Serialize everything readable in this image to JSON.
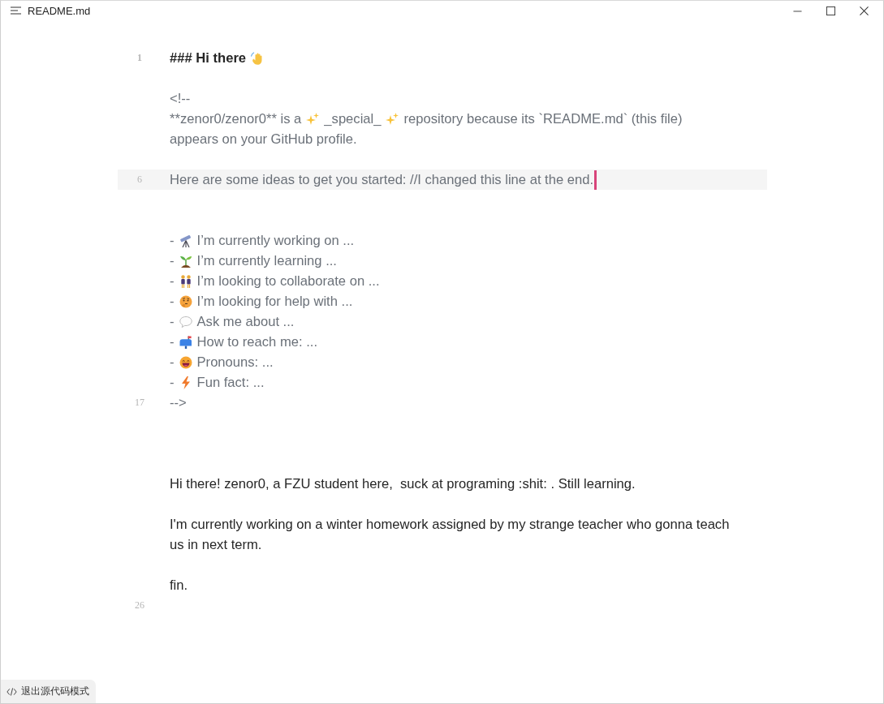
{
  "window": {
    "title": "README.md"
  },
  "editor": {
    "rows": [
      {
        "number": "1",
        "kind": "heading",
        "current": false,
        "parts": [
          {
            "kind": "text",
            "text": "### Hi there"
          },
          {
            "kind": "emoji"
          }
        ]
      },
      {
        "kind": "blank",
        "current": false
      },
      {
        "kind": "comment",
        "current": false,
        "parts": [
          {
            "kind": "text",
            "text": "<!--"
          }
        ]
      },
      {
        "kind": "comment",
        "current": false,
        "parts": [
          {
            "kind": "text",
            "text": "**zenor0/zenor0** is a"
          },
          {
            "kind": "emoji"
          },
          {
            "kind": "text",
            "text": "_special_"
          },
          {
            "kind": "emoji"
          },
          {
            "kind": "text",
            "text": "repository because its `README.md` (this file)"
          }
        ]
      },
      {
        "kind": "comment",
        "current": false,
        "parts": [
          {
            "kind": "text",
            "text": "appears on your GitHub profile."
          }
        ]
      },
      {
        "kind": "blank",
        "current": false
      },
      {
        "number": "6",
        "kind": "comment",
        "current": true,
        "parts": [
          {
            "kind": "text",
            "text": "Here are some ideas to get you started: //I changed this line at the end."
          }
        ]
      },
      {
        "kind": "blank",
        "current": false
      },
      {
        "kind": "blank",
        "current": false
      },
      {
        "kind": "comment",
        "current": false,
        "parts": [
          {
            "kind": "marker",
            "text": "-"
          },
          {
            "kind": "emoji"
          },
          {
            "kind": "text",
            "text": "I’m currently working on ..."
          }
        ]
      },
      {
        "kind": "comment",
        "current": false,
        "parts": [
          {
            "kind": "marker",
            "text": "-"
          },
          {
            "kind": "emoji"
          },
          {
            "kind": "text",
            "text": "I’m currently learning ..."
          }
        ]
      },
      {
        "kind": "comment",
        "current": false,
        "parts": [
          {
            "kind": "marker",
            "text": "-"
          },
          {
            "kind": "emoji"
          },
          {
            "kind": "text",
            "text": "I’m looking to collaborate on ..."
          }
        ]
      },
      {
        "kind": "comment",
        "current": false,
        "parts": [
          {
            "kind": "marker",
            "text": "-"
          },
          {
            "kind": "emoji"
          },
          {
            "kind": "text",
            "text": "I’m looking for help with ..."
          }
        ]
      },
      {
        "kind": "comment",
        "current": false,
        "parts": [
          {
            "kind": "marker",
            "text": "-"
          },
          {
            "kind": "emoji"
          },
          {
            "kind": "text",
            "text": "Ask me about ..."
          }
        ]
      },
      {
        "kind": "comment",
        "current": false,
        "parts": [
          {
            "kind": "marker",
            "text": "-"
          },
          {
            "kind": "emoji"
          },
          {
            "kind": "text",
            "text": "How to reach me: ..."
          }
        ]
      },
      {
        "kind": "comment",
        "current": false,
        "parts": [
          {
            "kind": "marker",
            "text": "-"
          },
          {
            "kind": "emoji"
          },
          {
            "kind": "text",
            "text": "Pronouns: ..."
          }
        ]
      },
      {
        "kind": "comment",
        "current": false,
        "parts": [
          {
            "kind": "marker",
            "text": "-"
          },
          {
            "kind": "emoji"
          },
          {
            "kind": "text",
            "text": "Fun fact: ..."
          }
        ]
      },
      {
        "number": "17",
        "kind": "comment",
        "current": false,
        "parts": [
          {
            "kind": "text",
            "text": "-->"
          }
        ]
      },
      {
        "kind": "blank",
        "current": false
      },
      {
        "kind": "blank",
        "current": false
      },
      {
        "kind": "blank",
        "current": false
      },
      {
        "kind": "paragraph",
        "current": false,
        "parts": [
          {
            "kind": "text",
            "text": "Hi there! zenor0, a FZU student here,  suck at programing :shit: . Still learning."
          }
        ]
      },
      {
        "kind": "blank",
        "current": false
      },
      {
        "kind": "paragraph",
        "current": false,
        "parts": [
          {
            "kind": "text",
            "text": "I'm currently working on a winter homework assigned by my strange teacher who gonna teach us in next term."
          }
        ]
      },
      {
        "kind": "blank",
        "current": false
      },
      {
        "kind": "paragraph",
        "current": false,
        "parts": [
          {
            "kind": "text",
            "text": "fin."
          }
        ]
      },
      {
        "number": "26",
        "kind": "blank",
        "current": false
      }
    ]
  },
  "mode_button": {
    "label": "退出源代码模式"
  }
}
